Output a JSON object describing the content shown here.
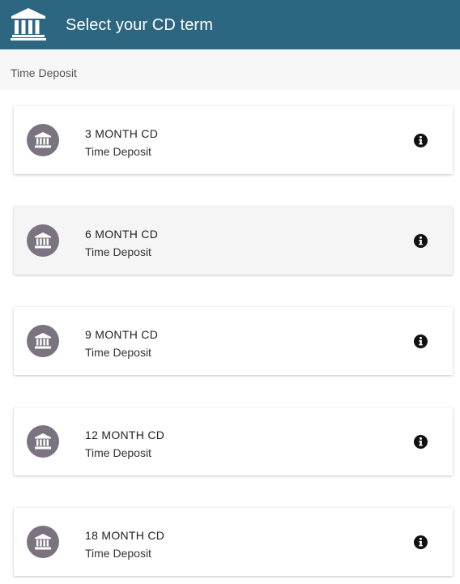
{
  "header": {
    "title": "Select your CD term",
    "icon": "bank-icon",
    "background": "#2c6680"
  },
  "breadcrumb": {
    "label": "Time Deposit"
  },
  "terms": [
    {
      "title": "3 MONTH CD",
      "subtitle": "Time Deposit",
      "icon": "bank-icon",
      "info_icon": "info-icon"
    },
    {
      "title": "6 MONTH CD",
      "subtitle": "Time Deposit",
      "icon": "bank-icon",
      "info_icon": "info-icon"
    },
    {
      "title": "9 MONTH CD",
      "subtitle": "Time Deposit",
      "icon": "bank-icon",
      "info_icon": "info-icon"
    },
    {
      "title": "12 MONTH CD",
      "subtitle": "Time Deposit",
      "icon": "bank-icon",
      "info_icon": "info-icon"
    },
    {
      "title": "18 MONTH CD",
      "subtitle": "Time Deposit",
      "icon": "bank-icon",
      "info_icon": "info-icon"
    }
  ],
  "colors": {
    "avatar": "#7b7480",
    "hover_card": "#f5f5f5"
  }
}
